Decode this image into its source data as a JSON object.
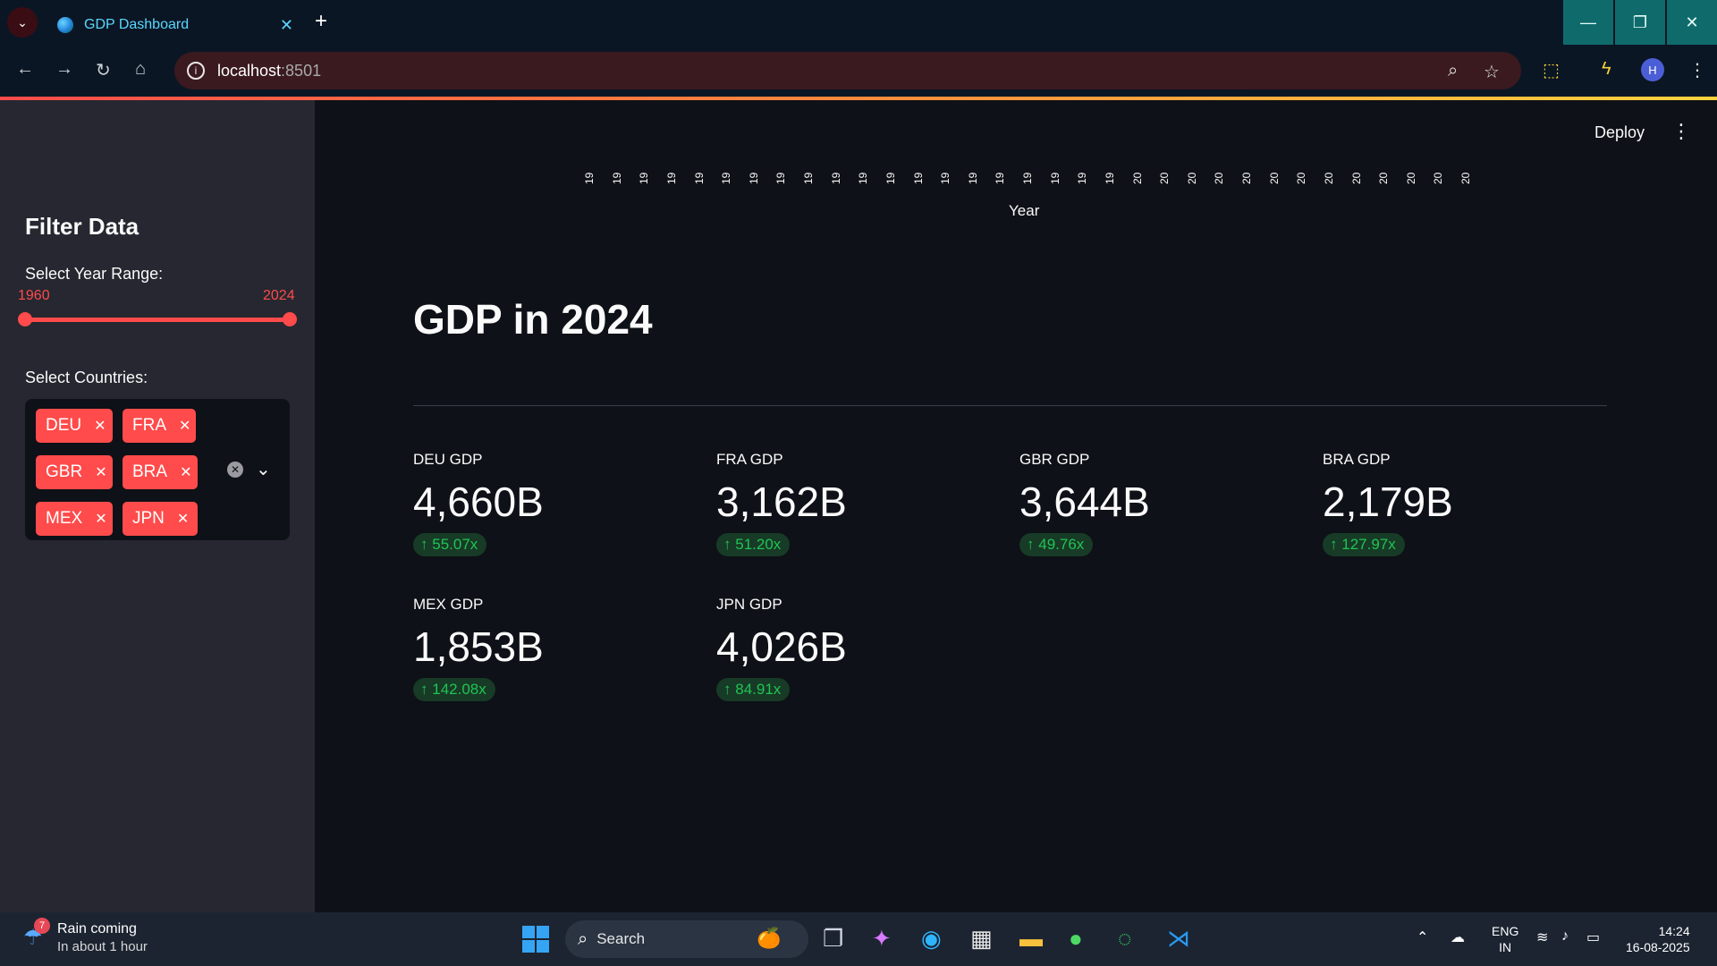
{
  "browser": {
    "tab_title": "GDP Dashboard",
    "url_host": "localhost",
    "url_port": ":8501"
  },
  "sidebar": {
    "title": "Filter Data",
    "year_range_label": "Select Year Range:",
    "year_min": "1960",
    "year_max": "2024",
    "countries_label": "Select Countries:",
    "selected_countries": [
      "DEU",
      "FRA",
      "GBR",
      "BRA",
      "MEX",
      "JPN"
    ]
  },
  "header": {
    "deploy_label": "Deploy"
  },
  "chart_axis": {
    "tick_labels": [
      "19",
      "19",
      "19",
      "19",
      "19",
      "19",
      "19",
      "19",
      "19",
      "19",
      "19",
      "19",
      "19",
      "19",
      "19",
      "19",
      "19",
      "19",
      "19",
      "19",
      "20",
      "20",
      "20",
      "20",
      "20",
      "20",
      "20",
      "20",
      "20",
      "20",
      "20",
      "20",
      "20"
    ],
    "title": "Year"
  },
  "main": {
    "heading": "GDP in 2024",
    "metrics": [
      {
        "label": "DEU GDP",
        "value": "4,660B",
        "delta": "55.07x"
      },
      {
        "label": "FRA GDP",
        "value": "3,162B",
        "delta": "51.20x"
      },
      {
        "label": "GBR GDP",
        "value": "3,644B",
        "delta": "49.76x"
      },
      {
        "label": "BRA GDP",
        "value": "2,179B",
        "delta": "127.97x"
      },
      {
        "label": "MEX GDP",
        "value": "1,853B",
        "delta": "142.08x"
      },
      {
        "label": "JPN GDP",
        "value": "4,026B",
        "delta": "84.91x"
      }
    ]
  },
  "taskbar": {
    "weather_badge": "7",
    "weather_title": "Rain coming",
    "weather_sub": "In about 1 hour",
    "search_placeholder": "Search",
    "lang_1": "ENG",
    "lang_2": "IN",
    "time": "14:24",
    "date": "16-08-2025"
  },
  "colors": {
    "accent": "#ff4b4b",
    "delta_green": "#21c354",
    "sidebar_bg": "#262730",
    "main_bg": "#0e1117"
  }
}
